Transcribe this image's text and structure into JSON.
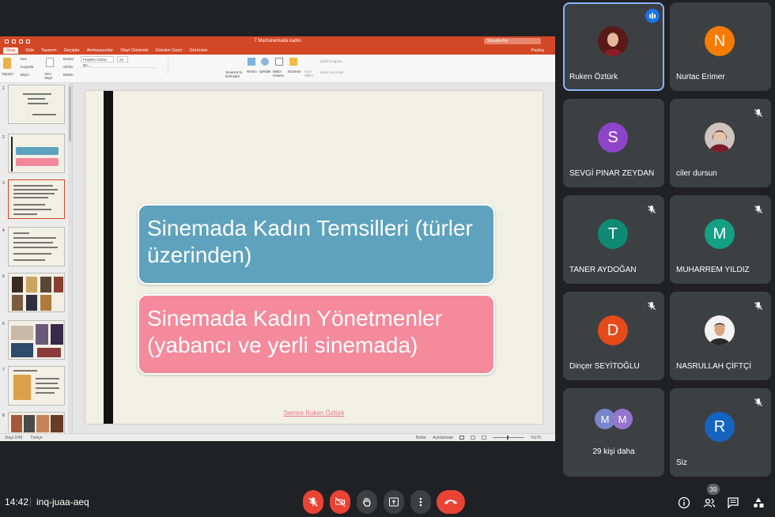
{
  "presentation": {
    "doc_title": "7 Martsinemada kadın",
    "search_placeholder": "Sunuda Ara",
    "tabs": [
      "Giriş",
      "Ekle",
      "Tasarım",
      "Geçişler",
      "Animasyonlar",
      "Slayt Gösterisi",
      "Gözden Geçir",
      "Görünüm"
    ],
    "share_label": "Paylaş",
    "ribbon": {
      "paste": "Yapıştır",
      "cut": "Kes",
      "copy": "Kopyala",
      "format": "Biçim",
      "new_slide": "Yeni Slayt",
      "layout": "Düzen",
      "reset": "Sıfırla",
      "section": "Bölüm",
      "font": "Franklin Gothic Bo...",
      "font_size": "24",
      "smartart": "SmartArt'a Dönüştür",
      "picture": "Resim",
      "shapes": "Şekiller",
      "textbox": "Metin Kutusu",
      "arrange": "Düzenle",
      "quick_styles": "Hızlı Stiller",
      "shape_fill": "Şekil Dolgusu",
      "shape_outline": "Şekil Ana Hattı"
    },
    "thumbnail_numbers": [
      "1",
      "2",
      "3",
      "4",
      "5",
      "6",
      "7",
      "8"
    ],
    "slide": {
      "box1": "Sinemada Kadın Temsilleri (türler üzerinden)",
      "box2": "Sinemada Kadın Yönetmenler (yabancı ve yerli sinemada)",
      "author": "Semire Ruken Öztürk"
    },
    "status": {
      "slide_count": "Slayt 2/49",
      "language": "Türkçe",
      "notes": "Notlar",
      "comments": "Açıklamalar",
      "zoom": "%176"
    }
  },
  "participants": [
    {
      "name": "Ruken Öztürk",
      "initial": "",
      "color": "",
      "speaking": true,
      "muted": false
    },
    {
      "name": "Nurtac Erimer",
      "initial": "N",
      "color": "#f57c00",
      "speaking": false,
      "muted": false
    },
    {
      "name": "SEVGİ PINAR ZEYDAN",
      "initial": "S",
      "color": "#8e44c9",
      "speaking": false,
      "muted": false
    },
    {
      "name": "ciler dursun",
      "initial": "",
      "color": "",
      "speaking": false,
      "muted": true
    },
    {
      "name": "TANER AYDOĞAN",
      "initial": "T",
      "color": "#0f8a74",
      "speaking": false,
      "muted": true
    },
    {
      "name": "MUHARREM YILDIZ",
      "initial": "M",
      "color": "#14a085",
      "speaking": false,
      "muted": true
    },
    {
      "name": "Dinçer SEYİTOĞLU",
      "initial": "D",
      "color": "#e64a19",
      "speaking": false,
      "muted": true
    },
    {
      "name": "NASRULLAH ÇİFTÇİ",
      "initial": "",
      "color": "",
      "speaking": false,
      "muted": true
    },
    {
      "name": "29 kişi daha",
      "initial": "M",
      "color": "#7986cb",
      "speaking": false,
      "muted": false
    },
    {
      "name": "Siz",
      "initial": "R",
      "color": "#1565c0",
      "speaking": false,
      "muted": true
    }
  ],
  "bottom_bar": {
    "time": "14:42",
    "meeting_code": "inq-juaa-aeq",
    "participant_count": "39"
  }
}
